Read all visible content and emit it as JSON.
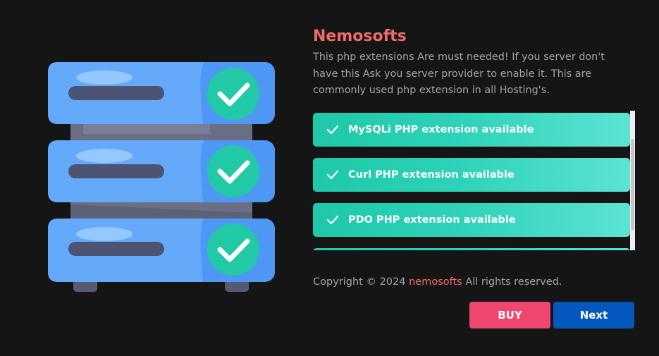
{
  "brand": {
    "title": "Nemosofts",
    "accent_color": "#f26b6b"
  },
  "description": "This php extensions Are must needed! If you server don't have this Ask you server provider to enable it. This are commonly used php extension in all Hosting's.",
  "extensions": [
    {
      "label": "MySQLi PHP extension available",
      "status": "available",
      "icon": "check-icon"
    },
    {
      "label": "Curl PHP extension available",
      "status": "available",
      "icon": "check-icon"
    },
    {
      "label": "PDO PHP extension available",
      "status": "available",
      "icon": "check-icon"
    },
    {
      "label": "",
      "status": "available",
      "icon": "check-icon"
    }
  ],
  "footer": {
    "copyright_prefix": "Copyright © 2024",
    "brand_link": "nemosofts",
    "copyright_suffix": "All rights reserved."
  },
  "buttons": {
    "buy_label": "BUY",
    "next_label": "Next",
    "buy_color": "#ef476f",
    "next_color": "#0457bc"
  },
  "illustration": {
    "icon": "server-rack-check-icon",
    "server_color": "#5a9ff8",
    "check_color": "#22c9a6"
  }
}
